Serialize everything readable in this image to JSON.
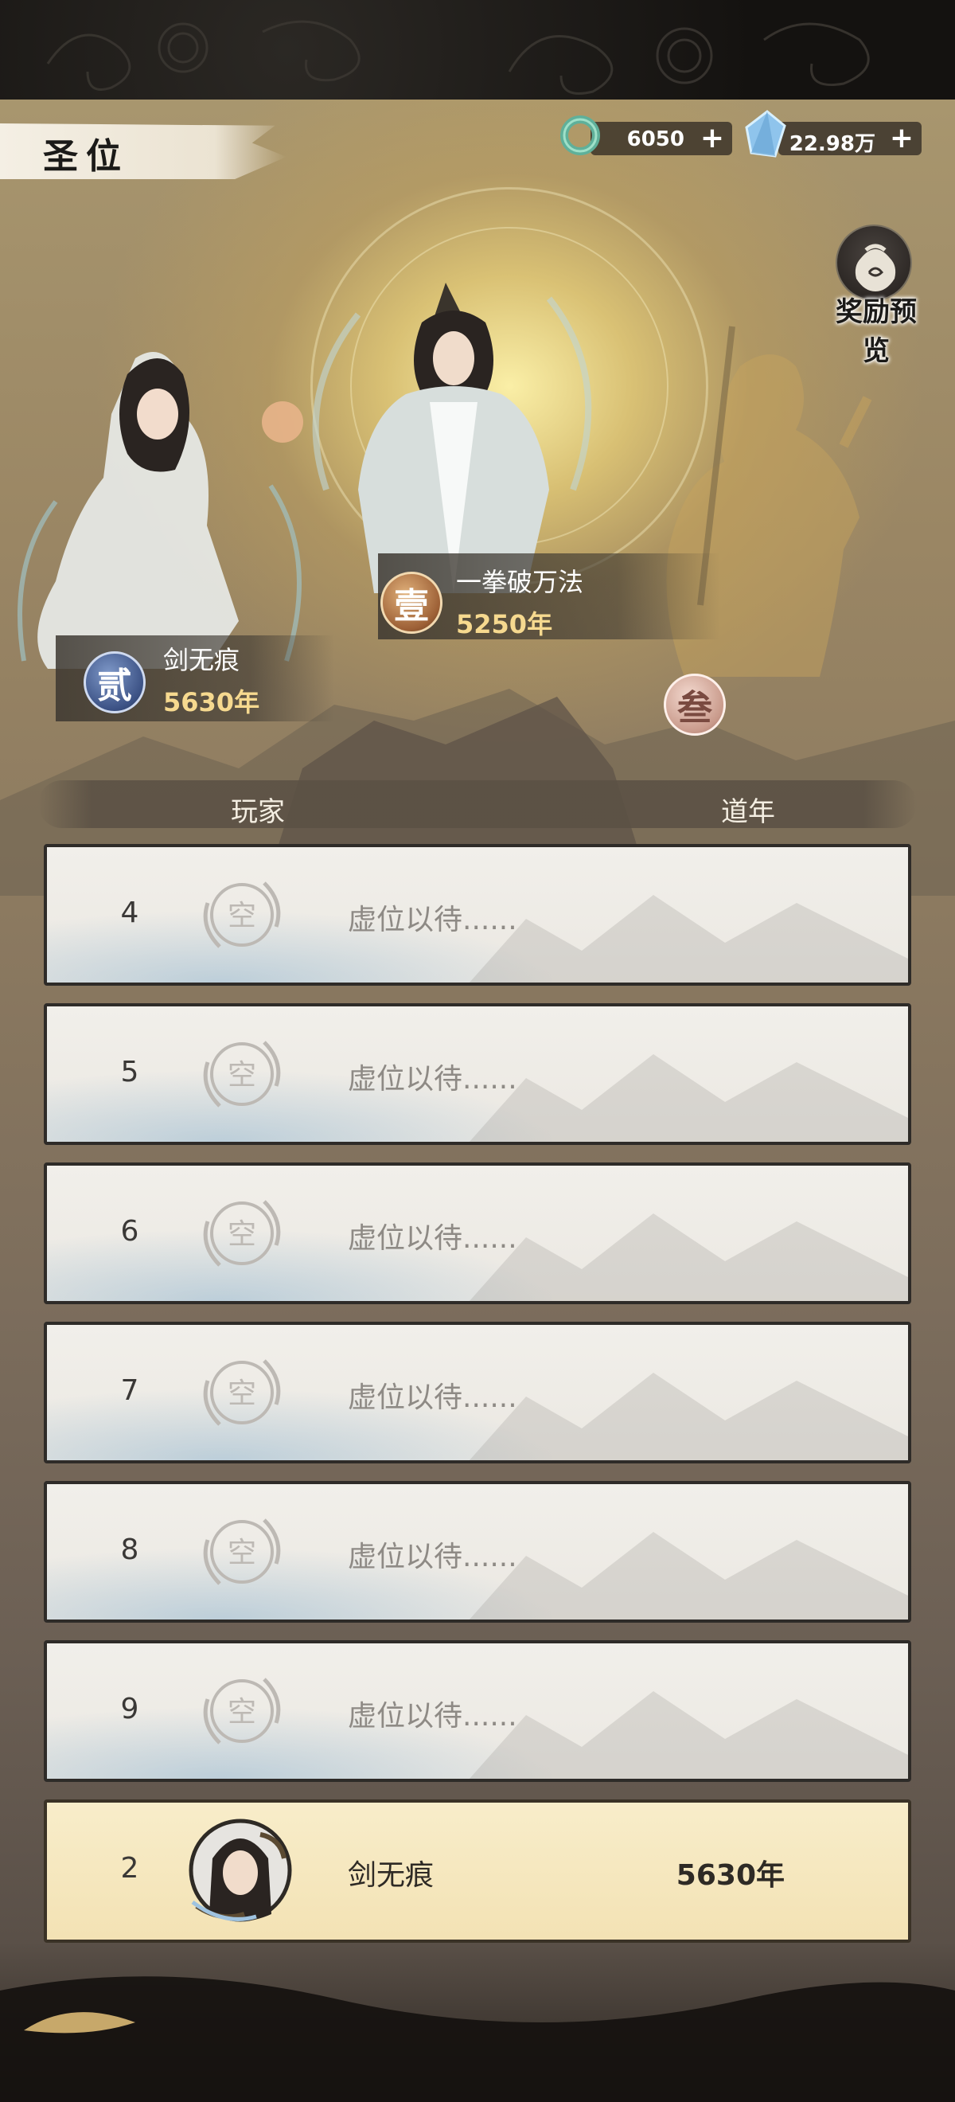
{
  "header": {
    "title": "圣位",
    "currency": [
      {
        "icon": "jade-ring-icon",
        "value": "6050",
        "plus": "+"
      },
      {
        "icon": "spirit-crystal-icon",
        "value": "22.98万",
        "plus": "+"
      }
    ],
    "reward_preview_label": "奖励预览"
  },
  "podium": [
    {
      "rank_glyph": "壹",
      "name": "一拳破万法",
      "years": "5250年"
    },
    {
      "rank_glyph": "贰",
      "name": "剑无痕",
      "years": "5630年"
    },
    {
      "rank_glyph": "叁"
    }
  ],
  "table": {
    "col_player": "玩家",
    "col_years": "道年",
    "rows": [
      {
        "rank": "4",
        "seal": "空",
        "name": "虚位以待......"
      },
      {
        "rank": "5",
        "seal": "空",
        "name": "虚位以待......"
      },
      {
        "rank": "6",
        "seal": "空",
        "name": "虚位以待......"
      },
      {
        "rank": "7",
        "seal": "空",
        "name": "虚位以待......"
      },
      {
        "rank": "8",
        "seal": "空",
        "name": "虚位以待......"
      },
      {
        "rank": "9",
        "seal": "空",
        "name": "虚位以待......"
      }
    ],
    "my_row": {
      "rank": "2",
      "name": "剑无痕",
      "years": "5630年"
    }
  },
  "colors": {
    "gold_text": "#f6d98f",
    "row_bg": "#ebe8e2",
    "my_row_bg": "#f3e2b4",
    "frame": "#2e2b28"
  }
}
